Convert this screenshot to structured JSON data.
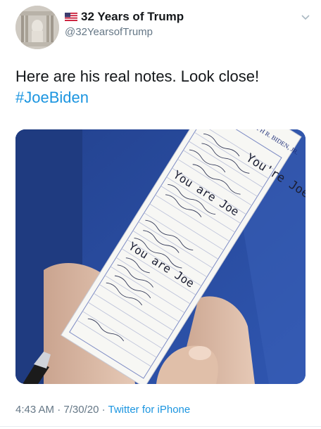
{
  "author": {
    "display_name": "32 Years of Trump",
    "handle": "@32YearsofTrump",
    "flag_icon": "us-flag-icon",
    "avatar_icon": "lincoln-memorial-avatar"
  },
  "tweet": {
    "line1": "Here are his real notes. Look close!",
    "hashtag": "#JoeBiden"
  },
  "media": {
    "note_header": "JOSEPH R. BIDEN, JR.",
    "note_scrawls": [
      "You're Joe",
      "You are Joe",
      "You are Joe"
    ]
  },
  "footer": {
    "time": "4:43 AM",
    "sep1": " · ",
    "date": "7/30/20",
    "sep2": " · ",
    "source": "Twitter for iPhone"
  },
  "colors": {
    "link": "#1b95e0",
    "muted": "#657786",
    "jacket": "#2a4a9a"
  }
}
